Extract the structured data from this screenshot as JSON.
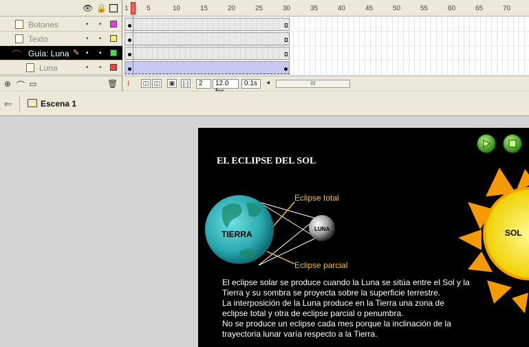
{
  "timeline": {
    "layers": [
      {
        "name": "Botones",
        "color": "#e040e0"
      },
      {
        "name": "Texto",
        "color": "#f0f060"
      },
      {
        "name": "Guía: Luna",
        "color": "#40e040"
      },
      {
        "name": "Luna",
        "color": "#f04040"
      }
    ],
    "ruler_ticks": [
      "1",
      "5",
      "10",
      "15",
      "20",
      "25",
      "30",
      "35",
      "40",
      "45",
      "50",
      "55",
      "60",
      "65",
      "70"
    ],
    "current_frame": "2",
    "frame_rate": "12.0 fps",
    "elapsed_time": "0.1s",
    "scroll_thumb": "III"
  },
  "scene": {
    "label": "Escena 1"
  },
  "stage": {
    "title": "EL ECLIPSE DEL SOL",
    "earth_label": "TIERRA",
    "moon_label": "LUNA",
    "sun_label": "SOL",
    "total_label": "Eclipse total",
    "partial_label": "Eclipse parcial",
    "description": [
      "El eclipse solar se produce cuando la Luna se sitúa entre el Sol y la",
      "Tierra y su sombra se proyecta sobre la superficie terrestre.",
      "La interposición de la Luna produce en la Tierra una zona de",
      "eclipse total y otra de eclipse parcial o penumbra.",
      "No se produce un eclipse cada mes porque la inclinación de la",
      "trayectoria lunar varía respecto a la Tierra."
    ]
  }
}
